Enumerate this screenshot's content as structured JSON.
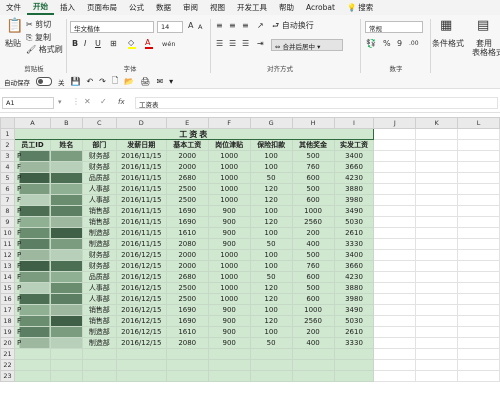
{
  "menu": {
    "items": [
      "文件",
      "开始",
      "插入",
      "页面布局",
      "公式",
      "数据",
      "审阅",
      "视图",
      "开发工具",
      "帮助",
      "Acrobat"
    ],
    "active_index": 1,
    "search_label": "搜索"
  },
  "ribbon": {
    "clipboard": {
      "paste": "粘贴",
      "cut": "剪切",
      "copy": "复制",
      "format_painter": "格式刷",
      "group": "剪贴板"
    },
    "font": {
      "name": "华文楷体",
      "size": "14",
      "grow": "A",
      "shrink": "A",
      "bold": "B",
      "italic": "I",
      "underline": "U",
      "wen": "wén",
      "group": "字体"
    },
    "alignment": {
      "wrap": "自动换行",
      "merge": "合并后居中",
      "group": "对齐方式"
    },
    "number": {
      "format": "常规",
      "percent": "%",
      "comma": "9",
      "group": "数字"
    },
    "styles": {
      "conditional": "条件格式",
      "table": "套用",
      "table2": "表格格式"
    }
  },
  "qat": {
    "autosave": "自动保存",
    "off": "关"
  },
  "formula_bar": {
    "name_box": "A1",
    "fx": "fx",
    "content": "工资表"
  },
  "sheet": {
    "columns": [
      "A",
      "B",
      "C",
      "D",
      "E",
      "F",
      "G",
      "H",
      "I",
      "J",
      "K",
      "L"
    ],
    "title": "工资表",
    "headers": [
      "员工ID",
      "姓名",
      "部门",
      "发薪日期",
      "基本工资",
      "岗位津贴",
      "保险扣款",
      "其他奖金",
      "实发工资"
    ],
    "rows": [
      {
        "id": "P",
        "dept": "财务部",
        "date": "2016/11/15",
        "base": "2000",
        "allow": "1000",
        "ins": "100",
        "bonus": "500",
        "net": "3400"
      },
      {
        "id": "F",
        "dept": "财务部",
        "date": "2016/11/15",
        "base": "2000",
        "allow": "1000",
        "ins": "100",
        "bonus": "760",
        "net": "3660"
      },
      {
        "id": "P",
        "dept": "品质部",
        "date": "2016/11/15",
        "base": "2680",
        "allow": "1000",
        "ins": "50",
        "bonus": "600",
        "net": "4230"
      },
      {
        "id": "P",
        "dept": "人事部",
        "date": "2016/11/15",
        "base": "2500",
        "allow": "1000",
        "ins": "120",
        "bonus": "500",
        "net": "3880"
      },
      {
        "id": "F",
        "dept": "人事部",
        "date": "2016/11/15",
        "base": "2500",
        "allow": "1000",
        "ins": "120",
        "bonus": "600",
        "net": "3980"
      },
      {
        "id": "P",
        "dept": "销售部",
        "date": "2016/11/15",
        "base": "1690",
        "allow": "900",
        "ins": "100",
        "bonus": "1000",
        "net": "3490"
      },
      {
        "id": "F",
        "dept": "销售部",
        "date": "2016/11/15",
        "base": "1690",
        "allow": "900",
        "ins": "120",
        "bonus": "2560",
        "net": "5030"
      },
      {
        "id": "F",
        "dept": "制造部",
        "date": "2016/11/15",
        "base": "1610",
        "allow": "900",
        "ins": "100",
        "bonus": "200",
        "net": "2610"
      },
      {
        "id": "P",
        "dept": "制造部",
        "date": "2016/11/15",
        "base": "2080",
        "allow": "900",
        "ins": "50",
        "bonus": "400",
        "net": "3330"
      },
      {
        "id": "P",
        "dept": "财务部",
        "date": "2016/12/15",
        "base": "2000",
        "allow": "1000",
        "ins": "100",
        "bonus": "500",
        "net": "3400"
      },
      {
        "id": "F",
        "dept": "财务部",
        "date": "2016/12/15",
        "base": "2000",
        "allow": "1000",
        "ins": "100",
        "bonus": "760",
        "net": "3660"
      },
      {
        "id": "F",
        "dept": "品质部",
        "date": "2016/12/15",
        "base": "2680",
        "allow": "1000",
        "ins": "50",
        "bonus": "600",
        "net": "4230"
      },
      {
        "id": "P",
        "dept": "人事部",
        "date": "2016/12/15",
        "base": "2500",
        "allow": "1000",
        "ins": "120",
        "bonus": "500",
        "net": "3880"
      },
      {
        "id": "P",
        "dept": "人事部",
        "date": "2016/12/15",
        "base": "2500",
        "allow": "1000",
        "ins": "120",
        "bonus": "600",
        "net": "3980"
      },
      {
        "id": "P",
        "dept": "销售部",
        "date": "2016/12/15",
        "base": "1690",
        "allow": "900",
        "ins": "100",
        "bonus": "1000",
        "net": "3490"
      },
      {
        "id": "F",
        "dept": "销售部",
        "date": "2016/12/15",
        "base": "1690",
        "allow": "900",
        "ins": "120",
        "bonus": "2560",
        "net": "5030"
      },
      {
        "id": "F",
        "dept": "制造部",
        "date": "2016/12/15",
        "base": "1610",
        "allow": "900",
        "ins": "100",
        "bonus": "200",
        "net": "2610"
      },
      {
        "id": "P",
        "dept": "制造部",
        "date": "2016/12/15",
        "base": "2080",
        "allow": "900",
        "ins": "50",
        "bonus": "400",
        "net": "3330"
      }
    ],
    "row_numbers": [
      "1",
      "2",
      "3",
      "4",
      "5",
      "6",
      "7",
      "8",
      "9",
      "10",
      "11",
      "12",
      "13",
      "14",
      "15",
      "16",
      "17",
      "18",
      "19",
      "20",
      "21",
      "22",
      "23"
    ]
  },
  "colors": {
    "accent": "#1d6b3c",
    "cell_fill": "#cfe8cf",
    "redacted": "#3f5f47"
  }
}
